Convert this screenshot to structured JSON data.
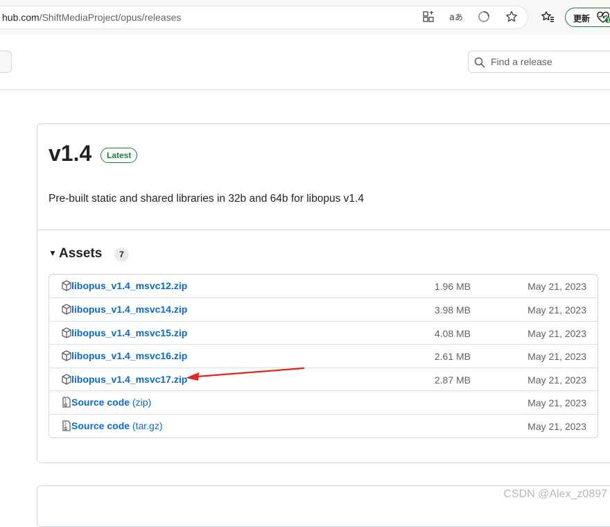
{
  "browser": {
    "url_host": "hub.com",
    "url_path": "/ShiftMediaProject/opus/releases",
    "update_label": "更新",
    "icons": [
      "apps-icon",
      "read-aloud-icon",
      "refresh-icon",
      "favorite-star-icon",
      "favorites-icon",
      "heart-pulse-icon"
    ]
  },
  "search": {
    "placeholder": "Find a release"
  },
  "release": {
    "title": "v1.4",
    "badge": "Latest",
    "description": "Pre-built static and shared libraries in 32b and 64b for libopus v1.4",
    "assets_label": "Assets",
    "assets_count": "7",
    "assets": [
      {
        "name": "libopus_v1.4_msvc12.zip",
        "size": "1.96 MB",
        "date": "May 21, 2023",
        "icon": "package-icon"
      },
      {
        "name": "libopus_v1.4_msvc14.zip",
        "size": "3.98 MB",
        "date": "May 21, 2023",
        "icon": "package-icon"
      },
      {
        "name": "libopus_v1.4_msvc15.zip",
        "size": "4.08 MB",
        "date": "May 21, 2023",
        "icon": "package-icon"
      },
      {
        "name": "libopus_v1.4_msvc16.zip",
        "size": "2.61 MB",
        "date": "May 21, 2023",
        "icon": "package-icon"
      },
      {
        "name": "libopus_v1.4_msvc17.zip",
        "size": "2.87 MB",
        "date": "May 21, 2023",
        "icon": "package-icon"
      }
    ],
    "sources": [
      {
        "name": "Source code",
        "ext": "(zip)",
        "date": "May 21, 2023",
        "icon": "file-zip-icon"
      },
      {
        "name": "Source code",
        "ext": "(tar.gz)",
        "date": "May 21, 2023",
        "icon": "file-zip-icon"
      }
    ]
  },
  "watermark": "CSDN @Alex_z0897",
  "colors": {
    "link": "#0969da",
    "latest_green": "#1a7f37",
    "annotation_red": "#e8231f"
  }
}
